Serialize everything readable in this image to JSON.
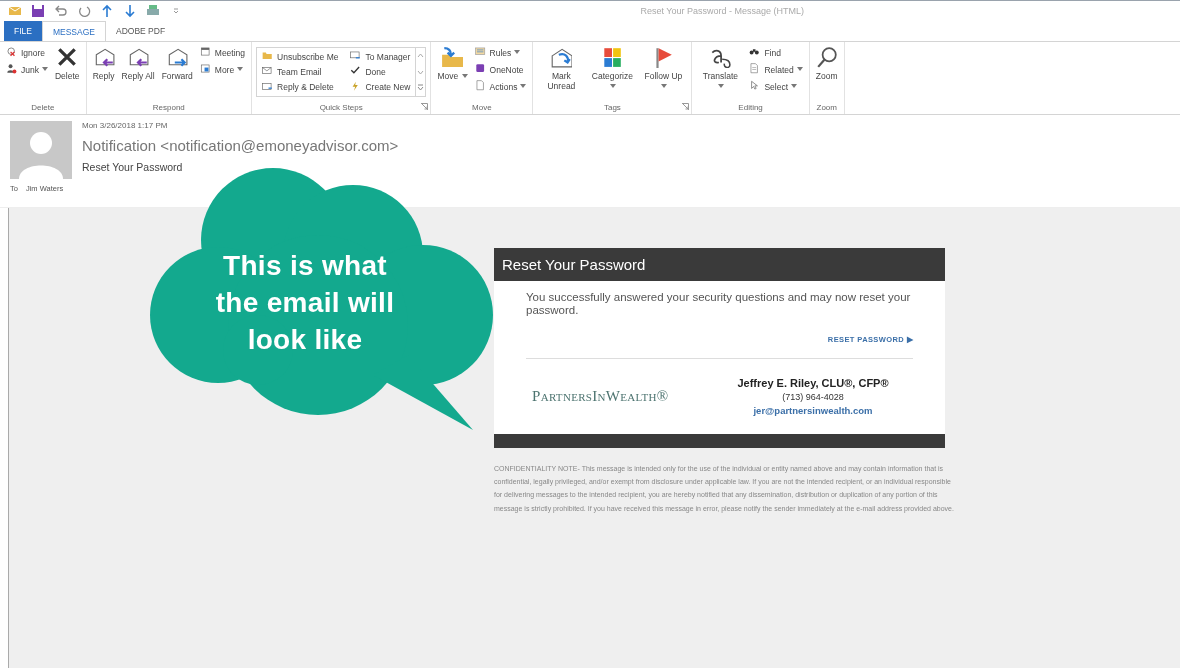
{
  "window": {
    "title": "Reset Your Password - Message (HTML)"
  },
  "tabs": [
    {
      "label": "FILE",
      "kind": "file",
      "selected": false
    },
    {
      "label": "MESSAGE",
      "kind": "tab",
      "selected": true
    },
    {
      "label": "ADOBE PDF",
      "kind": "tab",
      "selected": false
    }
  ],
  "ribbon": {
    "groups": [
      {
        "label": "Delete",
        "launcher": false,
        "items": [
          {
            "kind": "small",
            "label": "Ignore",
            "dropdown": false
          },
          {
            "kind": "small",
            "label": "Junk",
            "dropdown": true
          },
          {
            "kind": "large",
            "label": "Delete",
            "dropdown": false
          }
        ]
      },
      {
        "label": "Respond",
        "launcher": false,
        "items": [
          {
            "kind": "large",
            "label": "Reply",
            "dropdown": false
          },
          {
            "kind": "large",
            "label": "Reply All",
            "dropdown": false
          },
          {
            "kind": "large",
            "label": "Forward",
            "dropdown": false
          },
          {
            "kind": "small",
            "label": "Meeting",
            "dropdown": false
          },
          {
            "kind": "small",
            "label": "More",
            "dropdown": true
          }
        ]
      },
      {
        "label": "Quick Steps",
        "launcher": true,
        "items": [
          {
            "kind": "gallery",
            "label": "Unsubscribe Me"
          },
          {
            "kind": "gallery",
            "label": "Team Email"
          },
          {
            "kind": "gallery",
            "label": "Reply & Delete"
          },
          {
            "kind": "gallery",
            "label": "To Manager"
          },
          {
            "kind": "gallery",
            "label": "Done"
          },
          {
            "kind": "gallery",
            "label": "Create New"
          }
        ]
      },
      {
        "label": "Move",
        "launcher": false,
        "items": [
          {
            "kind": "large",
            "label": "Move",
            "dropdown": true
          },
          {
            "kind": "small",
            "label": "Rules",
            "dropdown": true
          },
          {
            "kind": "small",
            "label": "OneNote",
            "dropdown": false
          },
          {
            "kind": "small",
            "label": "Actions",
            "dropdown": true
          }
        ]
      },
      {
        "label": "Tags",
        "launcher": true,
        "items": [
          {
            "kind": "large",
            "label": "Mark Unread",
            "dropdown": false
          },
          {
            "kind": "large",
            "label": "Categorize",
            "dropdown": true
          },
          {
            "kind": "large",
            "label": "Follow Up",
            "dropdown": true
          }
        ]
      },
      {
        "label": "Editing",
        "launcher": false,
        "items": [
          {
            "kind": "large",
            "label": "Translate",
            "dropdown": true
          },
          {
            "kind": "small",
            "label": "Find",
            "dropdown": false
          },
          {
            "kind": "small",
            "label": "Related",
            "dropdown": true
          },
          {
            "kind": "small",
            "label": "Select",
            "dropdown": true
          }
        ]
      },
      {
        "label": "Zoom",
        "launcher": false,
        "items": [
          {
            "kind": "large",
            "label": "Zoom",
            "dropdown": false
          }
        ]
      }
    ]
  },
  "header": {
    "date": "Mon 3/26/2018 1:17 PM",
    "sender": "Notification <notification@emoneyadvisor.com>",
    "subject": "Reset Your Password",
    "to_label": "To",
    "to": "Jim Waters"
  },
  "callout": {
    "lines": [
      "This is what",
      "the email will",
      "look like"
    ]
  },
  "email": {
    "title": "Reset Your Password",
    "body": "You successfully answered your security questions and may now reset your password.",
    "link": "RESET PASSWORD ▶",
    "logo": "PartnersInWealth®",
    "signature_name": "Jeffrey E. Riley, CLU®, CFP®",
    "phone": "(713) 964-4028",
    "signature_email": "jer@partnersinwealth.com"
  },
  "confidentiality": "CONFIDENTIALITY NOTE- This message is intended only for the use of the individual or entity named above and may contain information that is confidential, legally privileged, and/or exempt from disclosure under applicable law. If you are not the intended recipient, or an individual responsible for delivering messages to the intended recipient, you are hereby notified that any dissemination, distribution or duplication of any portion of this message is strictly prohibited. If you have received this message in error, please notify the sender immediately at the e-mail address provided above."
}
